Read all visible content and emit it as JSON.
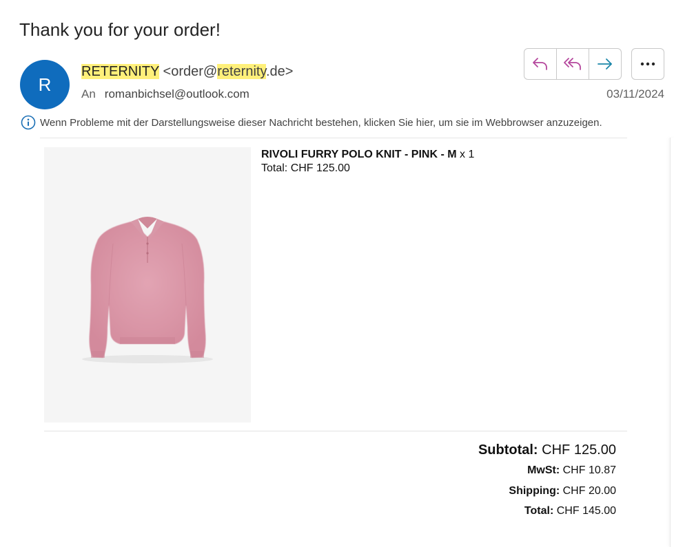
{
  "subject": "Thank you for your order!",
  "sender": {
    "avatar_letter": "R",
    "name": "RETERNITY",
    "email_prefix": "<order@",
    "email_domain_highlight": "reternity",
    "email_suffix": ".de>",
    "highlight_color": "#fff07a",
    "avatar_color": "#0f6cbd"
  },
  "recipient": {
    "label": "An",
    "address": "romanbichsel@outlook.com"
  },
  "date": "03/11/2024",
  "actions": {
    "reply_icon": "reply-icon",
    "reply_all_icon": "reply-all-icon",
    "forward_icon": "forward-icon",
    "more_icon": "more-options-icon"
  },
  "info_banner": "Wenn Probleme mit der Darstellungsweise dieser Nachricht bestehen, klicken Sie hier, um sie im Webbrowser anzuzeigen.",
  "order": {
    "item_name": "RIVOLI FURRY POLO KNIT - PINK - M",
    "item_qty": "x 1",
    "item_total": "Total: CHF 125.00",
    "image_icon": "pink-polo-knit-sweater-image"
  },
  "totals": {
    "subtotal_label": "Subtotal:",
    "subtotal_value": "CHF 125.00",
    "mwst_label": "MwSt:",
    "mwst_value": "CHF 10.87",
    "shipping_label": "Shipping:",
    "shipping_value": "CHF 20.00",
    "total_label": "Total:",
    "total_value": "CHF 145.00"
  }
}
